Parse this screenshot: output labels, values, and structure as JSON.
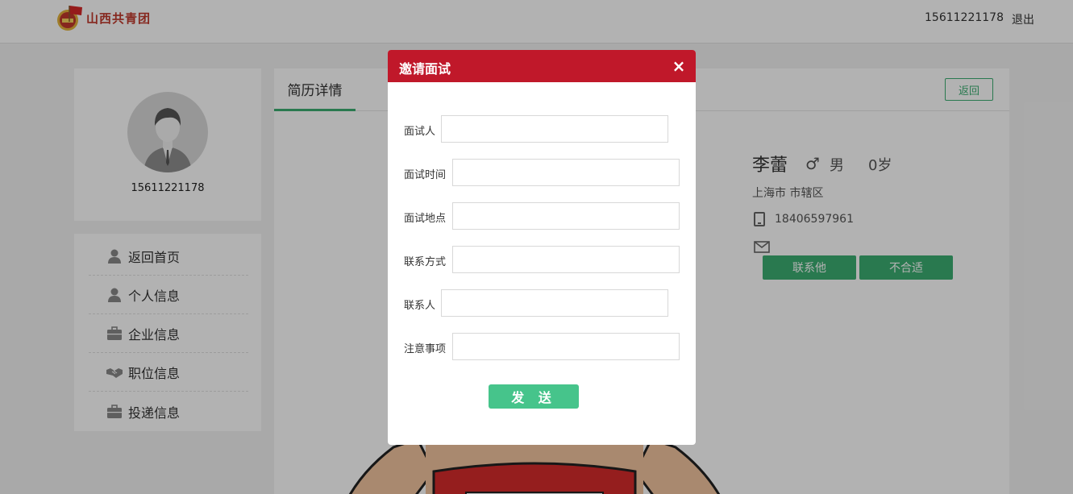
{
  "header": {
    "logo_text": "山西共青团",
    "phone": "15611221178",
    "logout": "退出"
  },
  "profile": {
    "phone": "15611221178"
  },
  "nav": {
    "items": [
      {
        "label": "返回首页",
        "icon": "user-icon"
      },
      {
        "label": "个人信息",
        "icon": "user-icon"
      },
      {
        "label": "企业信息",
        "icon": "briefcase-icon"
      },
      {
        "label": "职位信息",
        "icon": "handshake-icon"
      },
      {
        "label": "投递信息",
        "icon": "briefcase-icon"
      }
    ]
  },
  "main": {
    "tab": "简历详情",
    "back_button": "返回"
  },
  "resume": {
    "name": "李蕾",
    "gender_symbol": "♂",
    "gender": "男",
    "age": "0岁",
    "location": "上海市 市辖区",
    "phone": "18406597961",
    "contact_button": "联系他",
    "reject_button": "不合适"
  },
  "modal": {
    "title": "邀请面试",
    "close": "×",
    "fields": [
      {
        "label": "面试人",
        "value": ""
      },
      {
        "label": "面试时间",
        "value": ""
      },
      {
        "label": "面试地点",
        "value": ""
      },
      {
        "label": "联系方式",
        "value": ""
      },
      {
        "label": "联系人",
        "value": ""
      },
      {
        "label": "注意事项",
        "value": ""
      }
    ],
    "send_button": "发 送"
  },
  "colors": {
    "accent_green": "#3cae72",
    "modal_red": "#c0182a",
    "send_green": "#46c48b"
  }
}
